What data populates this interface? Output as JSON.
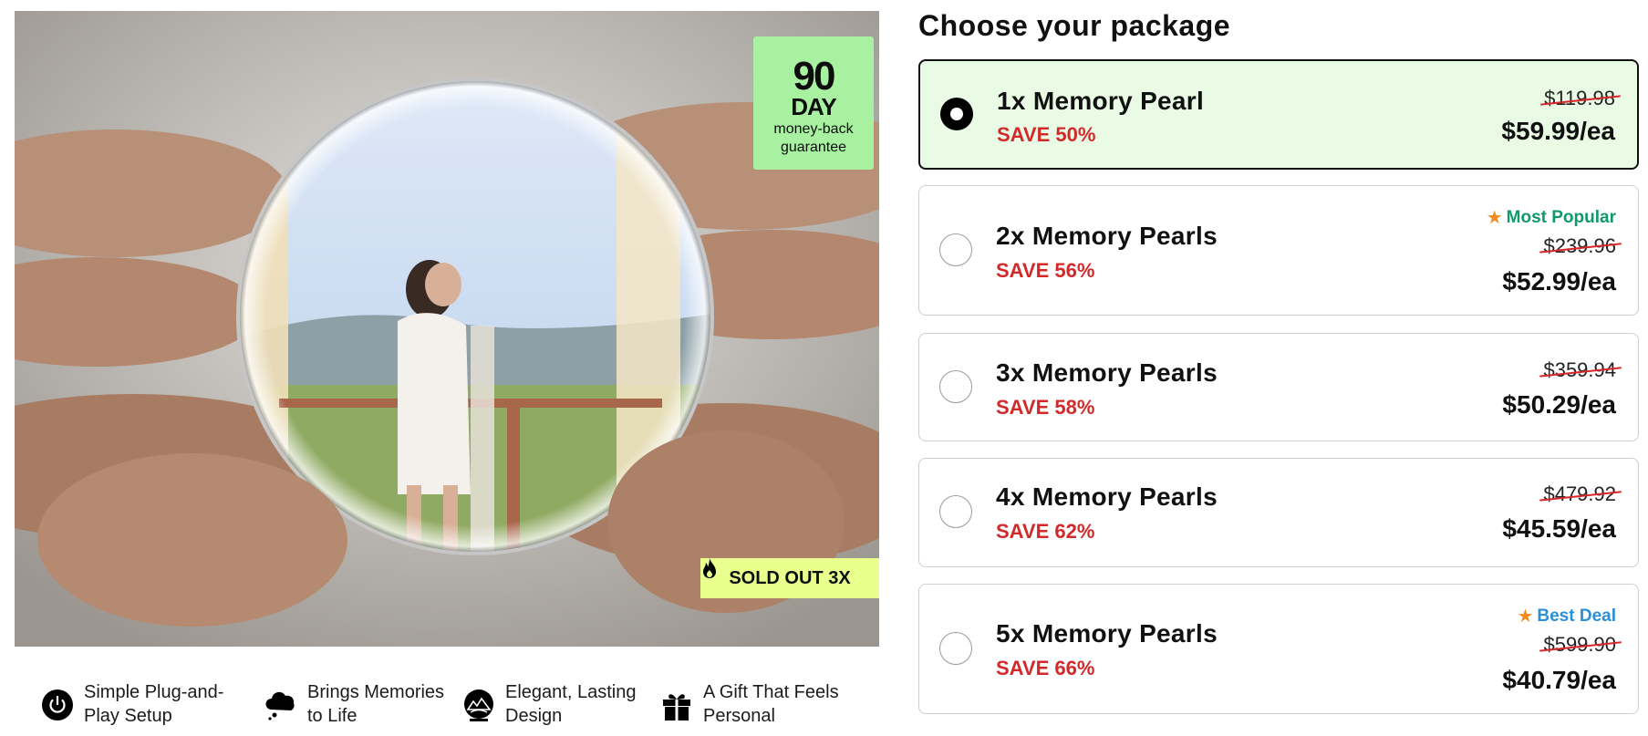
{
  "product": {
    "guarantee_number": "90",
    "guarantee_day": "DAY",
    "guarantee_line1": "money-back",
    "guarantee_line2": "guarantee",
    "sold_out": "SOLD OUT 3X"
  },
  "features": [
    {
      "label": "Simple Plug-and-Play Setup",
      "icon": "power-icon"
    },
    {
      "label": "Brings Memories to Life",
      "icon": "cloud-icon"
    },
    {
      "label": "Elegant, Lasting Design",
      "icon": "globe-landscape-icon"
    },
    {
      "label": "A Gift That Feels Personal",
      "icon": "gift-icon"
    }
  ],
  "packages": {
    "title": "Choose your package",
    "options": [
      {
        "name": "1x Memory Pearl",
        "save": "SAVE 50%",
        "old_price": "$119.98",
        "price": "$59.99/ea",
        "badge": "",
        "selected": true
      },
      {
        "name": "2x Memory Pearls",
        "save": "SAVE 56%",
        "old_price": "$239.96",
        "price": "$52.99/ea",
        "badge": "Most Popular",
        "selected": false
      },
      {
        "name": "3x Memory Pearls",
        "save": "SAVE 58%",
        "old_price": "$359.94",
        "price": "$50.29/ea",
        "badge": "",
        "selected": false
      },
      {
        "name": "4x Memory Pearls",
        "save": "SAVE 62%",
        "old_price": "$479.92",
        "price": "$45.59/ea",
        "badge": "",
        "selected": false
      },
      {
        "name": "5x Memory Pearls",
        "save": "SAVE 66%",
        "old_price": "$599.90",
        "price": "$40.79/ea",
        "badge": "Best Deal",
        "selected": false
      }
    ]
  },
  "colors": {
    "selected_bg": "#e9fbe4",
    "save_red": "#d22a2a",
    "most_popular": "#0f9a6a",
    "best_deal": "#2a8fd6",
    "guarantee_green": "#a7f1a0",
    "sold_out_bg": "#e9ff8e"
  }
}
